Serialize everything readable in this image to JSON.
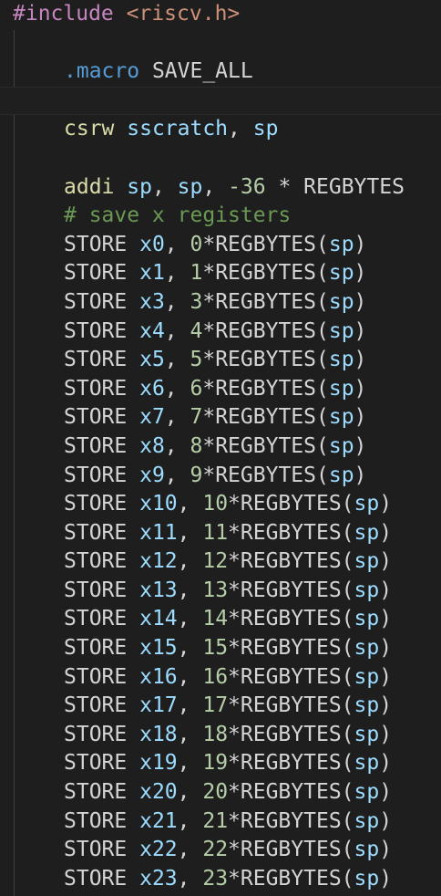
{
  "editor": {
    "language": "riscv-assembly",
    "colors": {
      "background": "#1e1e1e",
      "text": "#d4d4d4",
      "include": "#c586c0",
      "string": "#ce9178",
      "directive": "#569cd6",
      "instruction": "#dcdcaa",
      "register": "#9cdcfe",
      "number": "#b5cea8",
      "comment": "#6a9955"
    },
    "lines": [
      {
        "indent": false,
        "highlight": false,
        "tokens": [
          {
            "t": "#include",
            "c": "inc"
          },
          {
            "t": " ",
            "c": "plain"
          },
          {
            "t": "<riscv.h>",
            "c": "str"
          }
        ]
      },
      {
        "indent": false,
        "highlight": false,
        "tokens": []
      },
      {
        "indent": true,
        "highlight": false,
        "tokens": [
          {
            "t": ".macro",
            "c": "dir"
          },
          {
            "t": " SAVE_ALL",
            "c": "plain"
          }
        ]
      },
      {
        "indent": false,
        "highlight": true,
        "tokens": []
      },
      {
        "indent": true,
        "highlight": false,
        "tokens": [
          {
            "t": "csrw",
            "c": "kw"
          },
          {
            "t": " ",
            "c": "plain"
          },
          {
            "t": "sscratch",
            "c": "reg"
          },
          {
            "t": ", ",
            "c": "plain"
          },
          {
            "t": "sp",
            "c": "reg"
          }
        ]
      },
      {
        "indent": false,
        "highlight": false,
        "tokens": []
      },
      {
        "indent": true,
        "highlight": false,
        "tokens": [
          {
            "t": "addi",
            "c": "kw"
          },
          {
            "t": " ",
            "c": "plain"
          },
          {
            "t": "sp",
            "c": "reg"
          },
          {
            "t": ", ",
            "c": "plain"
          },
          {
            "t": "sp",
            "c": "reg"
          },
          {
            "t": ", ",
            "c": "plain"
          },
          {
            "t": "-36",
            "c": "num"
          },
          {
            "t": " * REGBYTES",
            "c": "plain"
          }
        ]
      },
      {
        "indent": true,
        "highlight": false,
        "tokens": [
          {
            "t": "# save x registers",
            "c": "cmt"
          }
        ]
      },
      {
        "indent": true,
        "highlight": false,
        "tokens": [
          {
            "t": "STORE ",
            "c": "plain"
          },
          {
            "t": "x0",
            "c": "reg"
          },
          {
            "t": ", ",
            "c": "plain"
          },
          {
            "t": "0",
            "c": "num"
          },
          {
            "t": "*REGBYTES(",
            "c": "plain"
          },
          {
            "t": "sp",
            "c": "reg"
          },
          {
            "t": ")",
            "c": "plain"
          }
        ]
      },
      {
        "indent": true,
        "highlight": false,
        "tokens": [
          {
            "t": "STORE ",
            "c": "plain"
          },
          {
            "t": "x1",
            "c": "reg"
          },
          {
            "t": ", ",
            "c": "plain"
          },
          {
            "t": "1",
            "c": "num"
          },
          {
            "t": "*REGBYTES(",
            "c": "plain"
          },
          {
            "t": "sp",
            "c": "reg"
          },
          {
            "t": ")",
            "c": "plain"
          }
        ]
      },
      {
        "indent": true,
        "highlight": false,
        "tokens": [
          {
            "t": "STORE ",
            "c": "plain"
          },
          {
            "t": "x3",
            "c": "reg"
          },
          {
            "t": ", ",
            "c": "plain"
          },
          {
            "t": "3",
            "c": "num"
          },
          {
            "t": "*REGBYTES(",
            "c": "plain"
          },
          {
            "t": "sp",
            "c": "reg"
          },
          {
            "t": ")",
            "c": "plain"
          }
        ]
      },
      {
        "indent": true,
        "highlight": false,
        "tokens": [
          {
            "t": "STORE ",
            "c": "plain"
          },
          {
            "t": "x4",
            "c": "reg"
          },
          {
            "t": ", ",
            "c": "plain"
          },
          {
            "t": "4",
            "c": "num"
          },
          {
            "t": "*REGBYTES(",
            "c": "plain"
          },
          {
            "t": "sp",
            "c": "reg"
          },
          {
            "t": ")",
            "c": "plain"
          }
        ]
      },
      {
        "indent": true,
        "highlight": false,
        "tokens": [
          {
            "t": "STORE ",
            "c": "plain"
          },
          {
            "t": "x5",
            "c": "reg"
          },
          {
            "t": ", ",
            "c": "plain"
          },
          {
            "t": "5",
            "c": "num"
          },
          {
            "t": "*REGBYTES(",
            "c": "plain"
          },
          {
            "t": "sp",
            "c": "reg"
          },
          {
            "t": ")",
            "c": "plain"
          }
        ]
      },
      {
        "indent": true,
        "highlight": false,
        "tokens": [
          {
            "t": "STORE ",
            "c": "plain"
          },
          {
            "t": "x6",
            "c": "reg"
          },
          {
            "t": ", ",
            "c": "plain"
          },
          {
            "t": "6",
            "c": "num"
          },
          {
            "t": "*REGBYTES(",
            "c": "plain"
          },
          {
            "t": "sp",
            "c": "reg"
          },
          {
            "t": ")",
            "c": "plain"
          }
        ]
      },
      {
        "indent": true,
        "highlight": false,
        "tokens": [
          {
            "t": "STORE ",
            "c": "plain"
          },
          {
            "t": "x7",
            "c": "reg"
          },
          {
            "t": ", ",
            "c": "plain"
          },
          {
            "t": "7",
            "c": "num"
          },
          {
            "t": "*REGBYTES(",
            "c": "plain"
          },
          {
            "t": "sp",
            "c": "reg"
          },
          {
            "t": ")",
            "c": "plain"
          }
        ]
      },
      {
        "indent": true,
        "highlight": false,
        "tokens": [
          {
            "t": "STORE ",
            "c": "plain"
          },
          {
            "t": "x8",
            "c": "reg"
          },
          {
            "t": ", ",
            "c": "plain"
          },
          {
            "t": "8",
            "c": "num"
          },
          {
            "t": "*REGBYTES(",
            "c": "plain"
          },
          {
            "t": "sp",
            "c": "reg"
          },
          {
            "t": ")",
            "c": "plain"
          }
        ]
      },
      {
        "indent": true,
        "highlight": false,
        "tokens": [
          {
            "t": "STORE ",
            "c": "plain"
          },
          {
            "t": "x9",
            "c": "reg"
          },
          {
            "t": ", ",
            "c": "plain"
          },
          {
            "t": "9",
            "c": "num"
          },
          {
            "t": "*REGBYTES(",
            "c": "plain"
          },
          {
            "t": "sp",
            "c": "reg"
          },
          {
            "t": ")",
            "c": "plain"
          }
        ]
      },
      {
        "indent": true,
        "highlight": false,
        "tokens": [
          {
            "t": "STORE ",
            "c": "plain"
          },
          {
            "t": "x10",
            "c": "reg"
          },
          {
            "t": ", ",
            "c": "plain"
          },
          {
            "t": "10",
            "c": "num"
          },
          {
            "t": "*REGBYTES(",
            "c": "plain"
          },
          {
            "t": "sp",
            "c": "reg"
          },
          {
            "t": ")",
            "c": "plain"
          }
        ]
      },
      {
        "indent": true,
        "highlight": false,
        "tokens": [
          {
            "t": "STORE ",
            "c": "plain"
          },
          {
            "t": "x11",
            "c": "reg"
          },
          {
            "t": ", ",
            "c": "plain"
          },
          {
            "t": "11",
            "c": "num"
          },
          {
            "t": "*REGBYTES(",
            "c": "plain"
          },
          {
            "t": "sp",
            "c": "reg"
          },
          {
            "t": ")",
            "c": "plain"
          }
        ]
      },
      {
        "indent": true,
        "highlight": false,
        "tokens": [
          {
            "t": "STORE ",
            "c": "plain"
          },
          {
            "t": "x12",
            "c": "reg"
          },
          {
            "t": ", ",
            "c": "plain"
          },
          {
            "t": "12",
            "c": "num"
          },
          {
            "t": "*REGBYTES(",
            "c": "plain"
          },
          {
            "t": "sp",
            "c": "reg"
          },
          {
            "t": ")",
            "c": "plain"
          }
        ]
      },
      {
        "indent": true,
        "highlight": false,
        "tokens": [
          {
            "t": "STORE ",
            "c": "plain"
          },
          {
            "t": "x13",
            "c": "reg"
          },
          {
            "t": ", ",
            "c": "plain"
          },
          {
            "t": "13",
            "c": "num"
          },
          {
            "t": "*REGBYTES(",
            "c": "plain"
          },
          {
            "t": "sp",
            "c": "reg"
          },
          {
            "t": ")",
            "c": "plain"
          }
        ]
      },
      {
        "indent": true,
        "highlight": false,
        "tokens": [
          {
            "t": "STORE ",
            "c": "plain"
          },
          {
            "t": "x14",
            "c": "reg"
          },
          {
            "t": ", ",
            "c": "plain"
          },
          {
            "t": "14",
            "c": "num"
          },
          {
            "t": "*REGBYTES(",
            "c": "plain"
          },
          {
            "t": "sp",
            "c": "reg"
          },
          {
            "t": ")",
            "c": "plain"
          }
        ]
      },
      {
        "indent": true,
        "highlight": false,
        "tokens": [
          {
            "t": "STORE ",
            "c": "plain"
          },
          {
            "t": "x15",
            "c": "reg"
          },
          {
            "t": ", ",
            "c": "plain"
          },
          {
            "t": "15",
            "c": "num"
          },
          {
            "t": "*REGBYTES(",
            "c": "plain"
          },
          {
            "t": "sp",
            "c": "reg"
          },
          {
            "t": ")",
            "c": "plain"
          }
        ]
      },
      {
        "indent": true,
        "highlight": false,
        "tokens": [
          {
            "t": "STORE ",
            "c": "plain"
          },
          {
            "t": "x16",
            "c": "reg"
          },
          {
            "t": ", ",
            "c": "plain"
          },
          {
            "t": "16",
            "c": "num"
          },
          {
            "t": "*REGBYTES(",
            "c": "plain"
          },
          {
            "t": "sp",
            "c": "reg"
          },
          {
            "t": ")",
            "c": "plain"
          }
        ]
      },
      {
        "indent": true,
        "highlight": false,
        "tokens": [
          {
            "t": "STORE ",
            "c": "plain"
          },
          {
            "t": "x17",
            "c": "reg"
          },
          {
            "t": ", ",
            "c": "plain"
          },
          {
            "t": "17",
            "c": "num"
          },
          {
            "t": "*REGBYTES(",
            "c": "plain"
          },
          {
            "t": "sp",
            "c": "reg"
          },
          {
            "t": ")",
            "c": "plain"
          }
        ]
      },
      {
        "indent": true,
        "highlight": false,
        "tokens": [
          {
            "t": "STORE ",
            "c": "plain"
          },
          {
            "t": "x18",
            "c": "reg"
          },
          {
            "t": ", ",
            "c": "plain"
          },
          {
            "t": "18",
            "c": "num"
          },
          {
            "t": "*REGBYTES(",
            "c": "plain"
          },
          {
            "t": "sp",
            "c": "reg"
          },
          {
            "t": ")",
            "c": "plain"
          }
        ]
      },
      {
        "indent": true,
        "highlight": false,
        "tokens": [
          {
            "t": "STORE ",
            "c": "plain"
          },
          {
            "t": "x19",
            "c": "reg"
          },
          {
            "t": ", ",
            "c": "plain"
          },
          {
            "t": "19",
            "c": "num"
          },
          {
            "t": "*REGBYTES(",
            "c": "plain"
          },
          {
            "t": "sp",
            "c": "reg"
          },
          {
            "t": ")",
            "c": "plain"
          }
        ]
      },
      {
        "indent": true,
        "highlight": false,
        "tokens": [
          {
            "t": "STORE ",
            "c": "plain"
          },
          {
            "t": "x20",
            "c": "reg"
          },
          {
            "t": ", ",
            "c": "plain"
          },
          {
            "t": "20",
            "c": "num"
          },
          {
            "t": "*REGBYTES(",
            "c": "plain"
          },
          {
            "t": "sp",
            "c": "reg"
          },
          {
            "t": ")",
            "c": "plain"
          }
        ]
      },
      {
        "indent": true,
        "highlight": false,
        "tokens": [
          {
            "t": "STORE ",
            "c": "plain"
          },
          {
            "t": "x21",
            "c": "reg"
          },
          {
            "t": ", ",
            "c": "plain"
          },
          {
            "t": "21",
            "c": "num"
          },
          {
            "t": "*REGBYTES(",
            "c": "plain"
          },
          {
            "t": "sp",
            "c": "reg"
          },
          {
            "t": ")",
            "c": "plain"
          }
        ]
      },
      {
        "indent": true,
        "highlight": false,
        "tokens": [
          {
            "t": "STORE ",
            "c": "plain"
          },
          {
            "t": "x22",
            "c": "reg"
          },
          {
            "t": ", ",
            "c": "plain"
          },
          {
            "t": "22",
            "c": "num"
          },
          {
            "t": "*REGBYTES(",
            "c": "plain"
          },
          {
            "t": "sp",
            "c": "reg"
          },
          {
            "t": ")",
            "c": "plain"
          }
        ]
      },
      {
        "indent": true,
        "highlight": false,
        "tokens": [
          {
            "t": "STORE ",
            "c": "plain"
          },
          {
            "t": "x23",
            "c": "reg"
          },
          {
            "t": ", ",
            "c": "plain"
          },
          {
            "t": "23",
            "c": "num"
          },
          {
            "t": "*REGBYTES(",
            "c": "plain"
          },
          {
            "t": "sp",
            "c": "reg"
          },
          {
            "t": ")",
            "c": "plain"
          }
        ]
      }
    ]
  }
}
